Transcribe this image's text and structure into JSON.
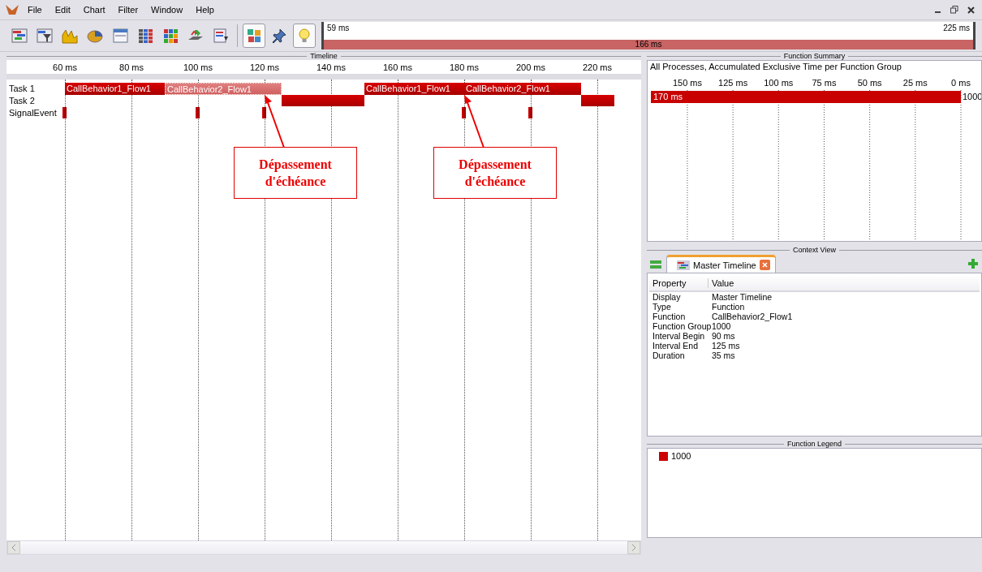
{
  "menu": [
    "File",
    "Edit",
    "Chart",
    "Filter",
    "Window",
    "Help"
  ],
  "toolbar": [
    {
      "pressed": false
    },
    {
      "pressed": false
    },
    {
      "pressed": false
    },
    {
      "pressed": false
    },
    {
      "pressed": false
    },
    {
      "pressed": false
    },
    {
      "pressed": false
    },
    {
      "pressed": false
    },
    {
      "pressed": false
    },
    {
      "pressed": true
    },
    {
      "pressed": false
    },
    {
      "pressed": true
    }
  ],
  "overview": {
    "start": "59 ms",
    "center": "166 ms",
    "end": "225 ms"
  },
  "timeline": {
    "title": "Timeline",
    "ticks": [
      "60 ms",
      "80 ms",
      "100 ms",
      "120 ms",
      "140 ms",
      "160 ms",
      "180 ms",
      "200 ms",
      "220 ms"
    ],
    "lanes": [
      {
        "name": "Task 1",
        "kind": "task",
        "segments": [
          {
            "label": "CallBehavior1_Flow1",
            "selected": false
          },
          {
            "label": "CallBehavior2_Flow1",
            "selected": true
          },
          {
            "label": "CallBehavior1_Flow1",
            "selected": false
          },
          {
            "label": "CallBehavior2_Flow1",
            "selected": false
          }
        ]
      },
      {
        "name": "Task 2",
        "kind": "task",
        "segments": [
          {
            "selected": false
          },
          {
            "selected": false
          }
        ]
      },
      {
        "name": "SignalEvent",
        "kind": "event"
      }
    ],
    "annotations": [
      {
        "text": "Dépassement d'échéance"
      },
      {
        "text": "Dépassement d'échéance"
      }
    ]
  },
  "function_summary": {
    "title": "Function Summary",
    "chart_data": {
      "type": "bar",
      "orientation": "horizontal",
      "grid": true,
      "title": "All Processes, Accumulated Exclusive Time per Function Group",
      "categories": [
        "1000"
      ],
      "values": [
        170
      ],
      "xlim": [
        170,
        0
      ],
      "xticks": [
        {
          "value": 150,
          "label": "150 ms"
        },
        {
          "value": 125,
          "label": "125 ms"
        },
        {
          "value": 100,
          "label": "100 ms"
        },
        {
          "value": 75,
          "label": "75 ms"
        },
        {
          "value": 50,
          "label": "50 ms"
        },
        {
          "value": 25,
          "label": "25 ms"
        },
        {
          "value": 0,
          "label": "0 ms"
        }
      ],
      "value_labels": [
        "170 ms"
      ]
    }
  },
  "context_view": {
    "title": "Context View",
    "tabs": [
      {
        "label": "Master Timeline",
        "selected": true
      }
    ],
    "columns": [
      "Property",
      "Value"
    ],
    "rows": [
      [
        "Display",
        "Master Timeline"
      ],
      [
        "Type",
        "Function"
      ],
      [
        "Function",
        "CallBehavior2_Flow1"
      ],
      [
        "Function Group",
        "1000"
      ],
      [
        "Interval Begin",
        "90 ms"
      ],
      [
        "Interval End",
        "125 ms"
      ],
      [
        "Duration",
        "35 ms"
      ]
    ]
  },
  "function_legend": {
    "title": "Function Legend",
    "items": [
      {
        "label": "1000",
        "color": "#cc0000"
      }
    ]
  }
}
